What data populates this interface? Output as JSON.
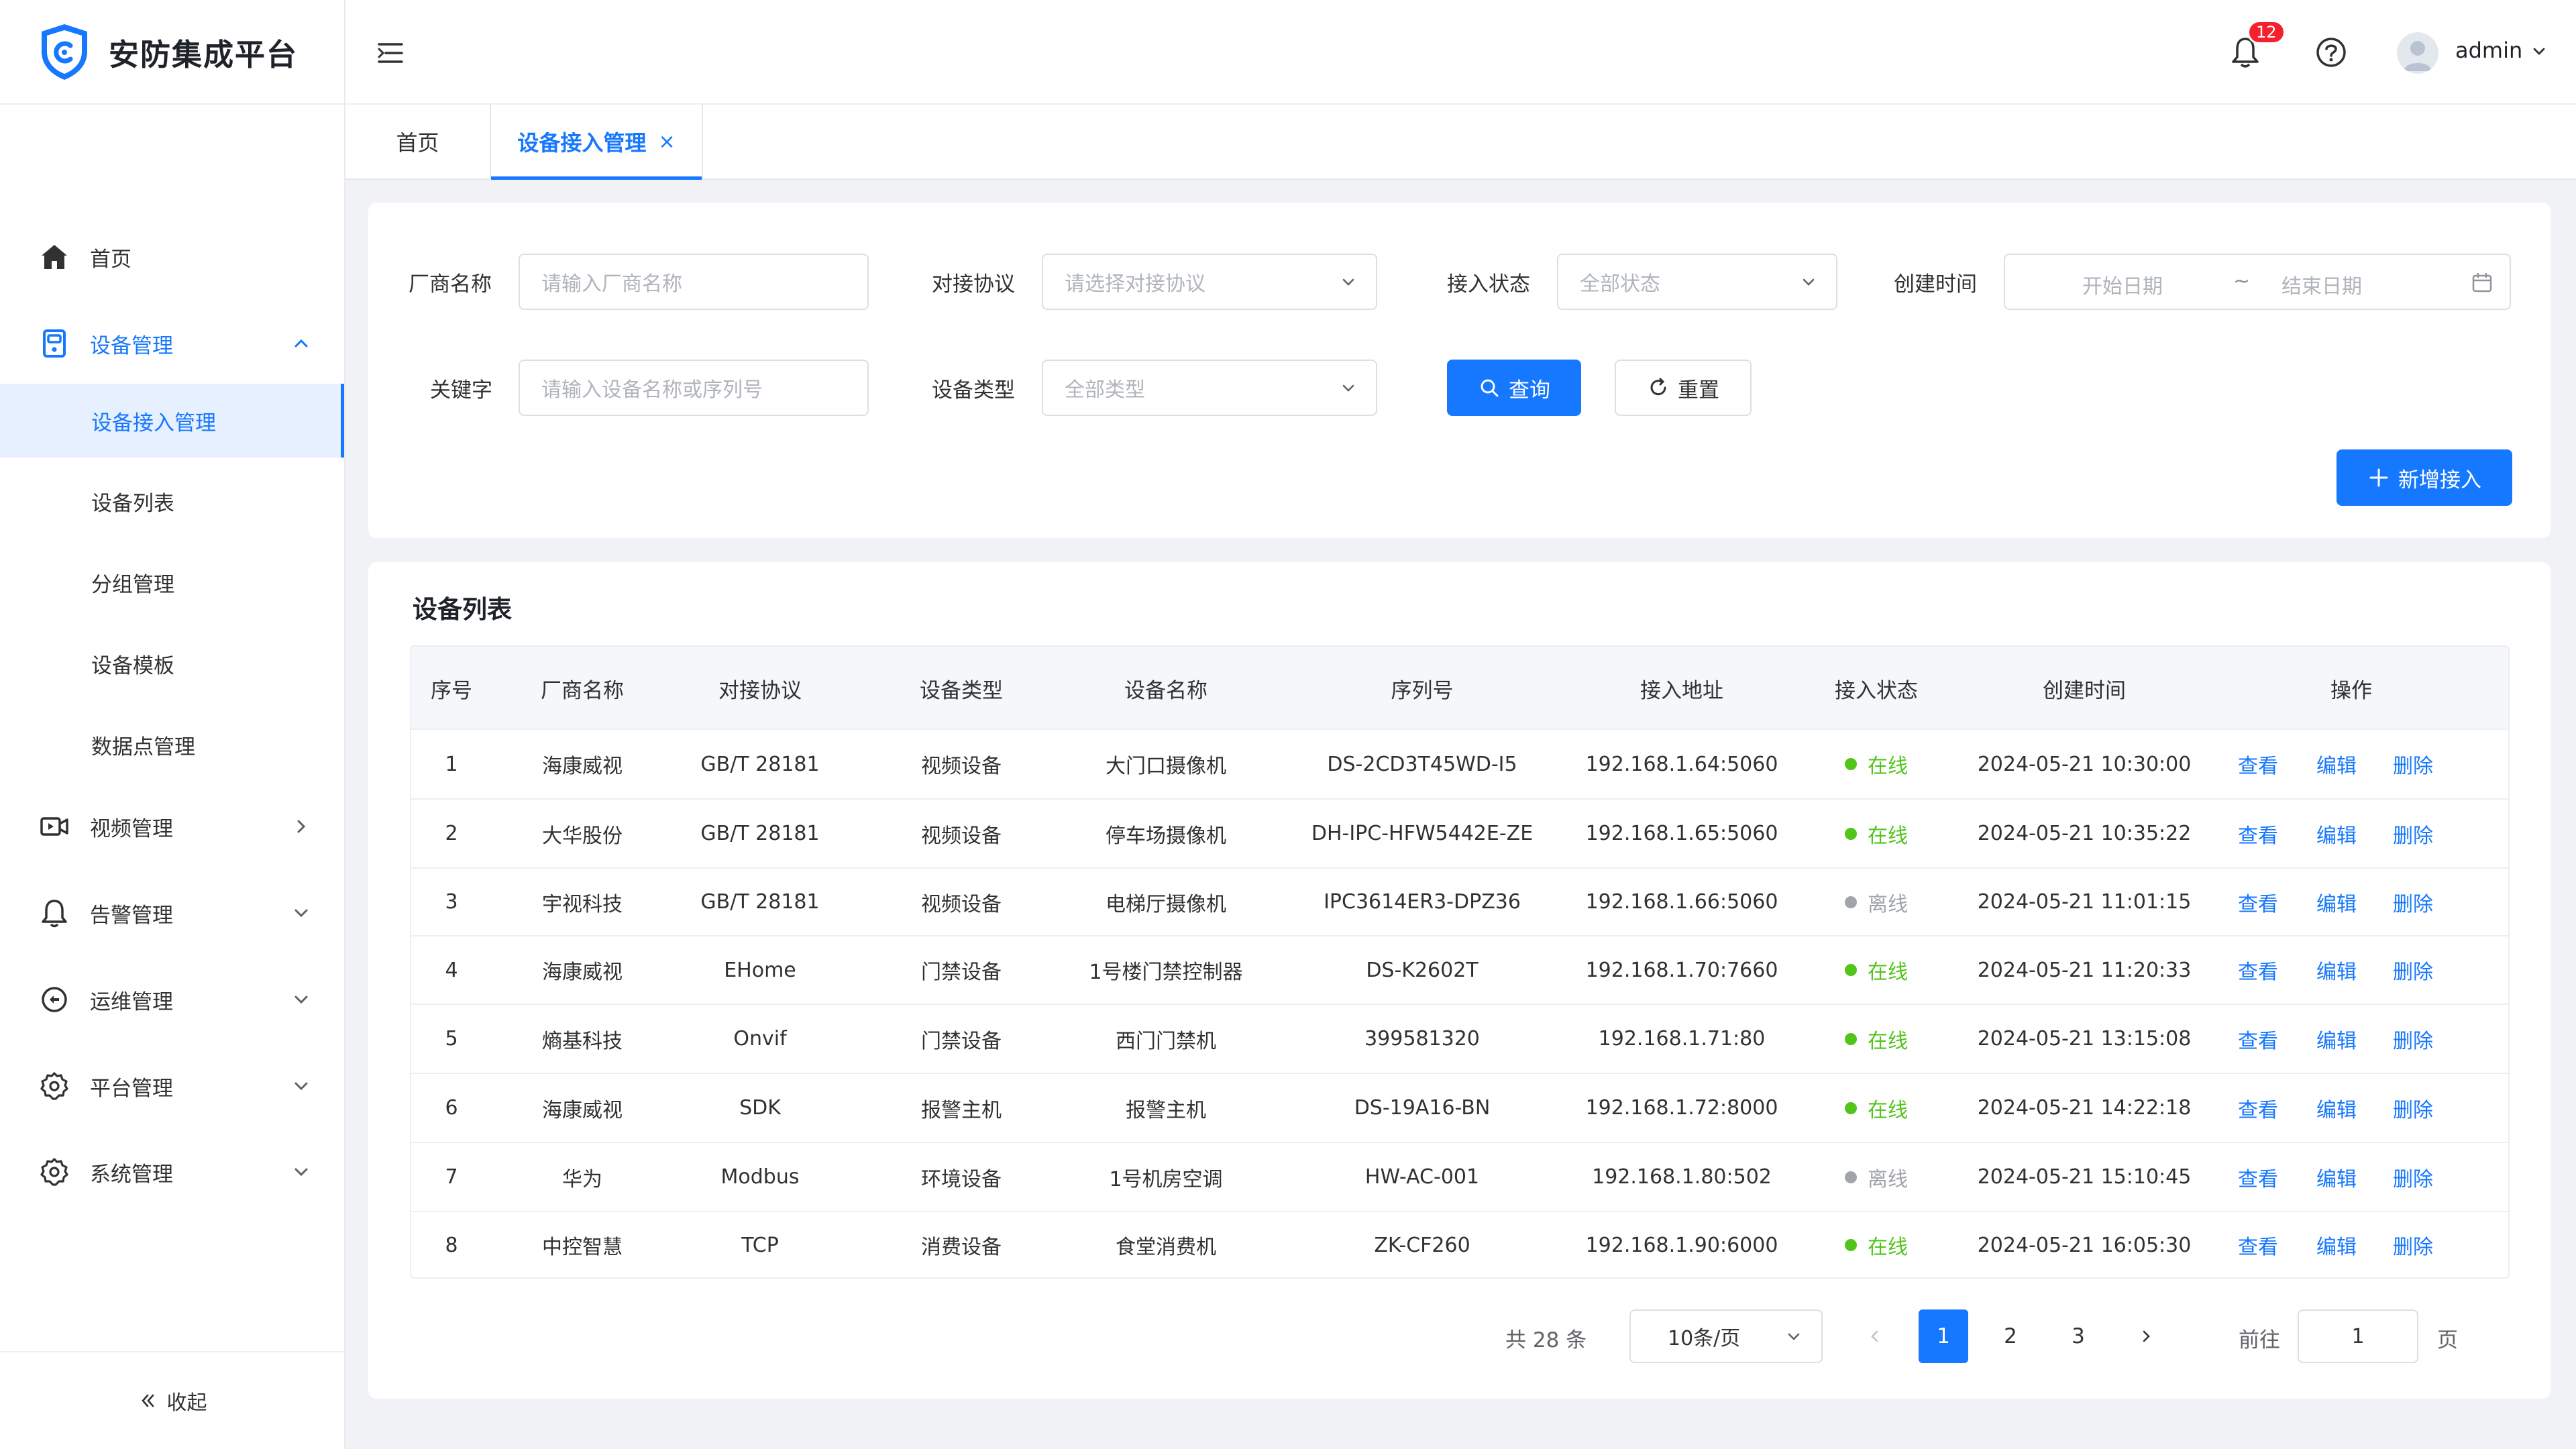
{
  "app": {
    "title": "安防集成平台",
    "brand_color": "#1677ff"
  },
  "sidebar": {
    "menu": [
      {
        "label": "首页",
        "icon": "home-icon"
      },
      {
        "label": "设备管理",
        "icon": "device-icon",
        "expanded": true,
        "children": [
          "设备接入管理",
          "设备列表",
          "分组管理",
          "设备模板",
          "数据点管理"
        ],
        "active_child": "设备接入管理"
      },
      {
        "label": "视频管理",
        "icon": "video-icon"
      },
      {
        "label": "告警管理",
        "icon": "alarm-bell-icon"
      },
      {
        "label": "运维管理",
        "icon": "ops-icon"
      },
      {
        "label": "平台管理",
        "icon": "gear-icon"
      },
      {
        "label": "系统管理",
        "icon": "gear-icon"
      }
    ],
    "collapse_label": "收起"
  },
  "header": {
    "notification_count": "12",
    "username": "admin"
  },
  "tabs": [
    {
      "label": "首页",
      "active": false
    },
    {
      "label": "设备接入管理",
      "active": true,
      "close": "×"
    }
  ],
  "filters": {
    "vendor": {
      "label": "厂商名称",
      "placeholder": "请输入厂商名称"
    },
    "protocol": {
      "label": "对接协议",
      "placeholder": "请选择对接协议"
    },
    "status": {
      "label": "接入状态",
      "placeholder": "全部状态"
    },
    "created": {
      "label": "创建时间",
      "start_placeholder": "开始日期",
      "separator": "~",
      "end_placeholder": "结束日期"
    },
    "keyword": {
      "label": "关键字",
      "placeholder": "请输入设备名称或序列号"
    },
    "device_type": {
      "label": "设备类型",
      "placeholder": "全部类型"
    },
    "search_label": "查询",
    "reset_label": "重置",
    "add_label": "新增接入"
  },
  "table": {
    "title": "设备列表",
    "columns": [
      "序号",
      "厂商名称",
      "对接协议",
      "设备类型",
      "设备名称",
      "序列号",
      "接入地址",
      "接入状态",
      "创建时间",
      "操作"
    ],
    "actions": [
      "查看",
      "编辑",
      "删除"
    ],
    "status_colors": {
      "在线": "#52c41a",
      "离线": "#a0a4ab"
    },
    "rows": [
      {
        "index": "1",
        "vendor": "海康威视",
        "protocol": "GB/T 28181",
        "type": "视频设备",
        "name": "大门口摄像机",
        "serial": "DS-2CD3T45WD-I5",
        "address": "192.168.1.64:5060",
        "status": "在线",
        "created": "2024-05-21 10:30:00"
      },
      {
        "index": "2",
        "vendor": "大华股份",
        "protocol": "GB/T 28181",
        "type": "视频设备",
        "name": "停车场摄像机",
        "serial": "DH-IPC-HFW5442E-ZE",
        "address": "192.168.1.65:5060",
        "status": "在线",
        "created": "2024-05-21 10:35:22"
      },
      {
        "index": "3",
        "vendor": "宇视科技",
        "protocol": "GB/T 28181",
        "type": "视频设备",
        "name": "电梯厅摄像机",
        "serial": "IPC3614ER3-DPZ36",
        "address": "192.168.1.66:5060",
        "status": "离线",
        "created": "2024-05-21 11:01:15"
      },
      {
        "index": "4",
        "vendor": "海康威视",
        "protocol": "EHome",
        "type": "门禁设备",
        "name": "1号楼门禁控制器",
        "serial": "DS-K2602T",
        "address": "192.168.1.70:7660",
        "status": "在线",
        "created": "2024-05-21 11:20:33"
      },
      {
        "index": "5",
        "vendor": "熵基科技",
        "protocol": "Onvif",
        "type": "门禁设备",
        "name": "西门门禁机",
        "serial": "399581320",
        "address": "192.168.1.71:80",
        "status": "在线",
        "created": "2024-05-21 13:15:08"
      },
      {
        "index": "6",
        "vendor": "海康威视",
        "protocol": "SDK",
        "type": "报警主机",
        "name": "报警主机",
        "serial": "DS-19A16-BN",
        "address": "192.168.1.72:8000",
        "status": "在线",
        "created": "2024-05-21 14:22:18"
      },
      {
        "index": "7",
        "vendor": "华为",
        "protocol": "Modbus",
        "type": "环境设备",
        "name": "1号机房空调",
        "serial": "HW-AC-001",
        "address": "192.168.1.80:502",
        "status": "离线",
        "created": "2024-05-21 15:10:45"
      },
      {
        "index": "8",
        "vendor": "中控智慧",
        "protocol": "TCP",
        "type": "消费设备",
        "name": "食堂消费机",
        "serial": "ZK-CF260",
        "address": "192.168.1.90:6000",
        "status": "在线",
        "created": "2024-05-21 16:05:30"
      }
    ]
  },
  "pagination": {
    "total_text": "共 28 条",
    "page_size": "10条/页",
    "pages": [
      "1",
      "2",
      "3"
    ],
    "current_page": "1",
    "goto_label": "前往",
    "goto_value": "1",
    "page_suffix": "页"
  }
}
